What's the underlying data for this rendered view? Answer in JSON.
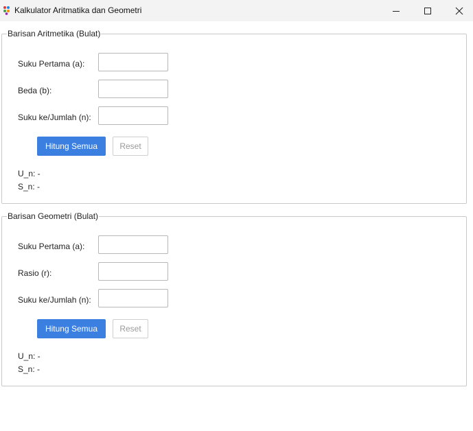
{
  "window": {
    "title": "Kalkulator Aritmatika dan Geometri",
    "icon": "app-dots-icon",
    "controls": [
      "minimize-icon",
      "maximize-icon",
      "close-icon"
    ]
  },
  "arithmetic": {
    "legend": "Barisan Aritmetika (Bulat)",
    "fields": [
      {
        "label": "Suku Pertama (a):",
        "value": ""
      },
      {
        "label": "Beda (b):",
        "value": ""
      },
      {
        "label": "Suku ke/Jumlah (n):",
        "value": ""
      }
    ],
    "calc_label": "Hitung Semua",
    "reset_label": "Reset",
    "un_result": "U_n: -",
    "sn_result": "S_n: -"
  },
  "geometric": {
    "legend": "Barisan Geometri (Bulat)",
    "fields": [
      {
        "label": "Suku Pertama (a):",
        "value": ""
      },
      {
        "label": "Rasio (r):",
        "value": ""
      },
      {
        "label": "Suku ke/Jumlah (n):",
        "value": ""
      }
    ],
    "calc_label": "Hitung Semua",
    "reset_label": "Reset",
    "un_result": "U_n: -",
    "sn_result": "S_n: -"
  },
  "colors": {
    "accent": "#3b7fe0",
    "titlebar": "#f3f3f3",
    "border": "#c9c9c9"
  }
}
